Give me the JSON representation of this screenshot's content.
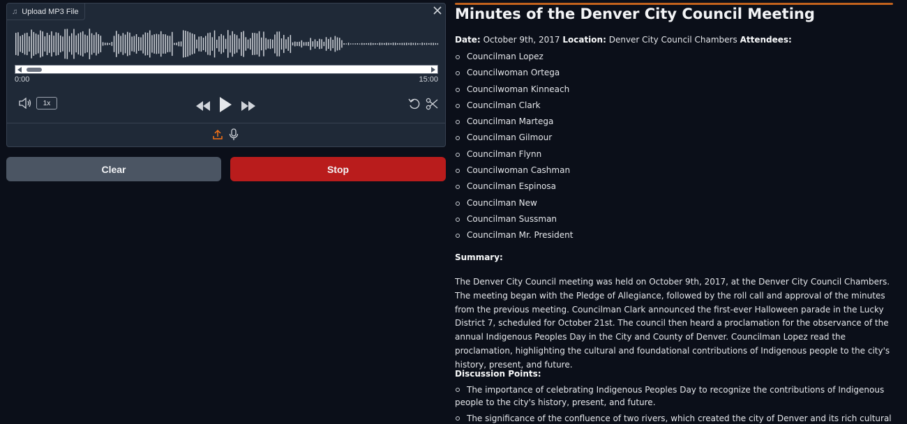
{
  "audio": {
    "upload_label": "Upload MP3 File",
    "time_start": "0:00",
    "time_end": "15:00",
    "playback_rate": "1x"
  },
  "buttons": {
    "clear": "Clear",
    "stop": "Stop"
  },
  "document": {
    "title": "Minutes of the Denver City Council Meeting",
    "date_label": "Date:",
    "date_value": "October 9th, 2017",
    "location_label": "Location:",
    "location_value": "Denver City Council Chambers",
    "attendees_label": "Attendees:",
    "attendees": [
      "Councilman Lopez",
      "Councilwoman Ortega",
      "Councilwoman Kinneach",
      "Councilman Clark",
      "Councilman Martega",
      "Councilman Gilmour",
      "Councilman Flynn",
      "Councilwoman Cashman",
      "Councilman Espinosa",
      "Councilman New",
      "Councilman Sussman",
      "Councilman Mr. President"
    ],
    "summary_label": "Summary:",
    "summary_text": "The Denver City Council meeting was held on October 9th, 2017, at the Denver City Council Chambers. The meeting began with the Pledge of Allegiance, followed by the roll call and approval of the minutes from the previous meeting. Councilman Clark announced the first-ever Halloween parade in the Lucky District 7, scheduled for October 21st. The council then heard a proclamation for the observance of the annual Indigenous Peoples Day in the City and County of Denver. Councilman Lopez read the proclamation, highlighting the cultural and foundational contributions of Indigenous people to the city's history, present, and future.",
    "discussion_label": "Discussion Points:",
    "discussion_points": [
      "The importance of celebrating Indigenous Peoples Day to recognize the contributions of Indigenous people to the city's history, present, and future.",
      "The significance of the confluence of two rivers, which created the city of Denver and its rich cultural heritage."
    ]
  },
  "colors": {
    "background": "#0b0f19",
    "panel": "#1f2937",
    "stop_button": "#b91c1c",
    "clear_button": "#4b5563",
    "accent_upload": "#f97316",
    "progress_line": "#c2621d"
  },
  "icons": [
    "music-note-icon",
    "close-icon",
    "volume-icon",
    "rewind-icon",
    "play-icon",
    "fast-forward-icon",
    "undo-icon",
    "scissors-icon",
    "upload-icon",
    "microphone-icon"
  ]
}
